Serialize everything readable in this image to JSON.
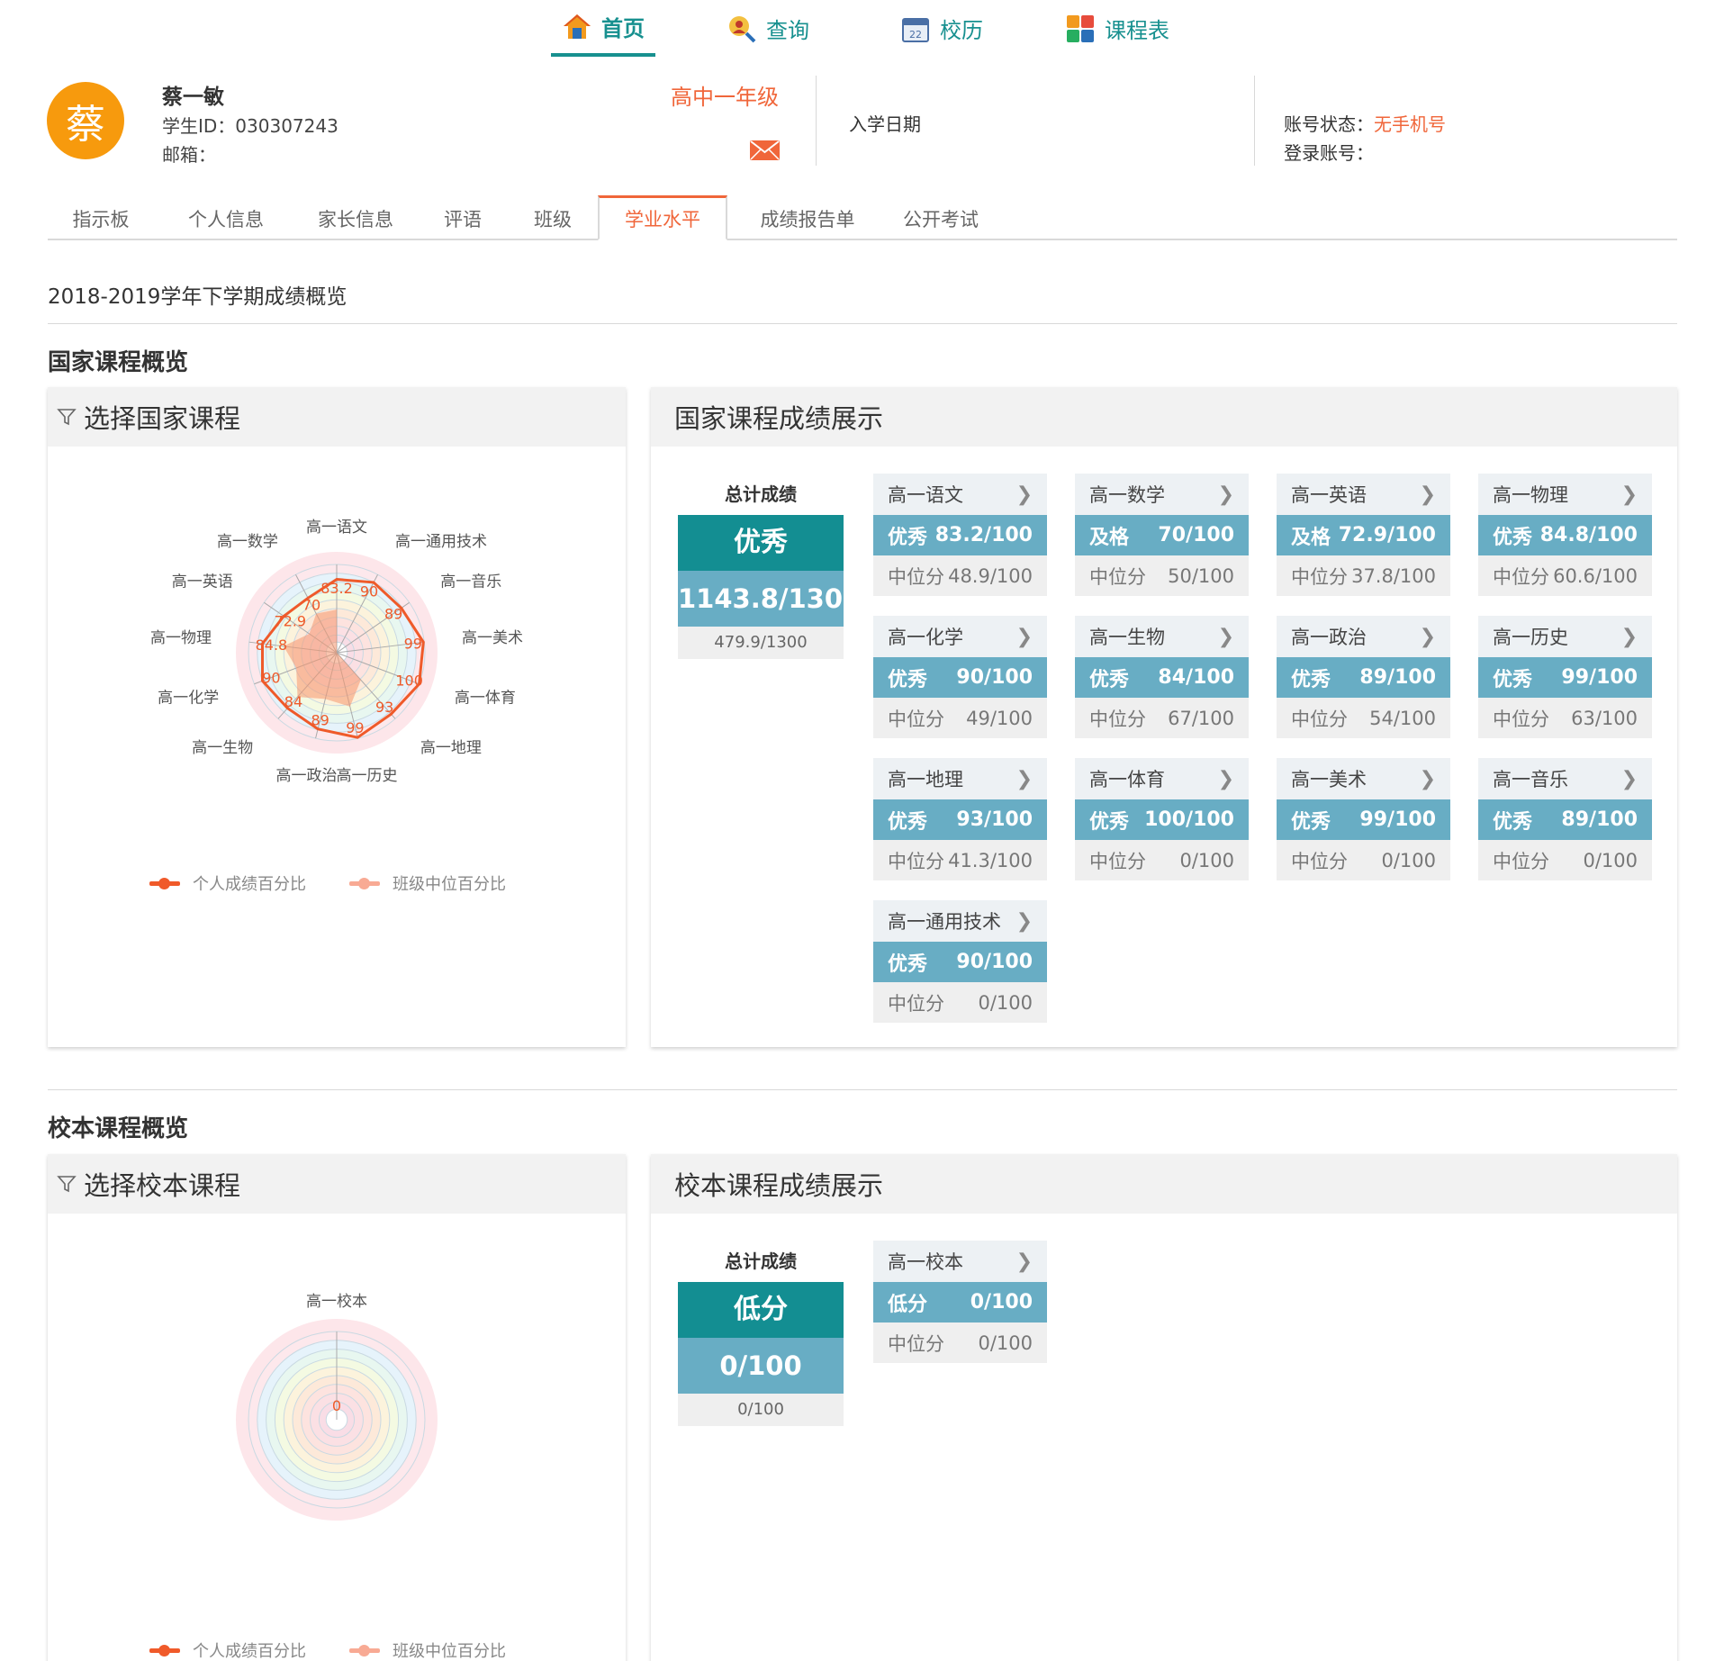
{
  "nav": [
    {
      "label": "首页",
      "icon": "home-icon",
      "active": true
    },
    {
      "label": "查询",
      "icon": "search-person-icon",
      "active": false
    },
    {
      "label": "校历",
      "icon": "calendar-icon",
      "active": false
    },
    {
      "label": "课程表",
      "icon": "schedule-icon",
      "active": false
    }
  ],
  "calendar_icon_text": "22",
  "profile": {
    "avatar_char": "蔡",
    "name": "蔡一敏",
    "student_id": "学生ID：030307243",
    "email": "邮箱：",
    "grade": "高中一年级",
    "enroll_date": "入学日期",
    "account_status_label": "账号状态：",
    "account_status_value": "无手机号",
    "login_account": "登录账号："
  },
  "tabs": [
    "指示板",
    "个人信息",
    "家长信息",
    "评语",
    "班级",
    "学业水平",
    "成绩报告单",
    "公开考试"
  ],
  "active_tab": 5,
  "semester_title": "2018-2019学年下学期成绩概览",
  "national": {
    "section_title": "国家课程概览",
    "select_title": "选择国家课程",
    "display_title": "国家课程成绩展示",
    "total": {
      "label": "总计成绩",
      "level": "优秀",
      "score": "1143.8/1300",
      "median": "479.9/1300"
    },
    "courses": [
      {
        "name": "高一语文",
        "level": "优秀",
        "score": "83.2/100",
        "median_label": "中位分",
        "median": "48.9/100"
      },
      {
        "name": "高一数学",
        "level": "及格",
        "score": "70/100",
        "median_label": "中位分",
        "median": "50/100"
      },
      {
        "name": "高一英语",
        "level": "及格",
        "score": "72.9/100",
        "median_label": "中位分",
        "median": "37.8/100"
      },
      {
        "name": "高一物理",
        "level": "优秀",
        "score": "84.8/100",
        "median_label": "中位分",
        "median": "60.6/100"
      },
      {
        "name": "高一化学",
        "level": "优秀",
        "score": "90/100",
        "median_label": "中位分",
        "median": "49/100"
      },
      {
        "name": "高一生物",
        "level": "优秀",
        "score": "84/100",
        "median_label": "中位分",
        "median": "67/100"
      },
      {
        "name": "高一政治",
        "level": "优秀",
        "score": "89/100",
        "median_label": "中位分",
        "median": "54/100"
      },
      {
        "name": "高一历史",
        "level": "优秀",
        "score": "99/100",
        "median_label": "中位分",
        "median": "63/100"
      },
      {
        "name": "高一地理",
        "level": "优秀",
        "score": "93/100",
        "median_label": "中位分",
        "median": "41.3/100"
      },
      {
        "name": "高一体育",
        "level": "优秀",
        "score": "100/100",
        "median_label": "中位分",
        "median": "0/100"
      },
      {
        "name": "高一美术",
        "level": "优秀",
        "score": "99/100",
        "median_label": "中位分",
        "median": "0/100"
      },
      {
        "name": "高一音乐",
        "level": "优秀",
        "score": "89/100",
        "median_label": "中位分",
        "median": "0/100"
      },
      {
        "name": "高一通用技术",
        "level": "优秀",
        "score": "90/100",
        "median_label": "中位分",
        "median": "0/100"
      }
    ],
    "legend": {
      "personal": "个人成绩百分比",
      "median": "班级中位百分比"
    }
  },
  "school": {
    "section_title": "校本课程概览",
    "select_title": "选择校本课程",
    "display_title": "校本课程成绩展示",
    "total": {
      "label": "总计成绩",
      "level": "低分",
      "score": "0/100",
      "median": "0/100"
    },
    "courses": [
      {
        "name": "高一校本",
        "level": "低分",
        "score": "0/100",
        "median_label": "中位分",
        "median": "0/100"
      }
    ],
    "legend": {
      "personal": "个人成绩百分比",
      "median": "班级中位百分比"
    }
  },
  "colors": {
    "accent": "#17908f",
    "orange": "#f0663a",
    "avatar": "#f79a0d",
    "level_bg": "#138e92",
    "score_bg": "#68adc4"
  },
  "chart_data": [
    {
      "type": "radar",
      "categories": [
        "高一语文",
        "高一通用技术",
        "高一音乐",
        "高一美术",
        "高一体育",
        "高一地理",
        "高一历史",
        "高一政治",
        "高一生物",
        "高一化学",
        "高一物理",
        "高一英语",
        "高一数学"
      ],
      "series": [
        {
          "name": "个人成绩百分比",
          "values": [
            83.2,
            90,
            89,
            99,
            100,
            93,
            99,
            89,
            84,
            90,
            84.8,
            72.9,
            70
          ]
        },
        {
          "name": "班级中位百分比",
          "values": [
            48.9,
            0,
            0,
            0,
            0,
            41.3,
            63,
            54,
            67,
            49,
            60.6,
            37.8,
            50
          ]
        }
      ],
      "value_labels": [
        "83.2",
        "90",
        "89",
        "99",
        "100",
        "93",
        "99",
        "89",
        "84",
        "90",
        "84.8",
        "72.9",
        "70"
      ],
      "range": [
        0,
        100
      ]
    },
    {
      "type": "radar",
      "categories": [
        "高一校本"
      ],
      "series": [
        {
          "name": "个人成绩百分比",
          "values": [
            0
          ]
        },
        {
          "name": "班级中位百分比",
          "values": [
            0
          ]
        }
      ],
      "value_labels": [
        "0"
      ],
      "range": [
        0,
        100
      ]
    }
  ]
}
